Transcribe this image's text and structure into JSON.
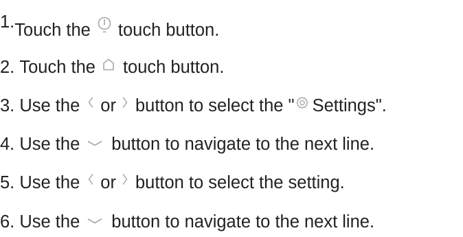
{
  "steps": [
    {
      "number": "1.",
      "parts": [
        "Touch the",
        "touch button."
      ],
      "icons": [
        "power-icon"
      ]
    },
    {
      "number": "2.",
      "parts": [
        "Touch the",
        "touch button."
      ],
      "icons": [
        "home-icon"
      ]
    },
    {
      "number": "3.",
      "parts": [
        "Use the",
        "or",
        "button to select the \"",
        "Settings\"."
      ],
      "icons": [
        "chevron-left-icon",
        "chevron-right-icon",
        "gear-icon"
      ]
    },
    {
      "number": "4.",
      "parts": [
        "Use the",
        "button to navigate to the next line."
      ],
      "icons": [
        "chevron-down-icon"
      ]
    },
    {
      "number": "5.",
      "parts": [
        "Use the",
        "or",
        "button to select the setting."
      ],
      "icons": [
        "chevron-left-icon",
        "chevron-right-icon"
      ]
    },
    {
      "number": "6.",
      "parts": [
        "Use the",
        "button to navigate to the next line."
      ],
      "icons": [
        "chevron-down-icon"
      ]
    }
  ],
  "colors": {
    "text": "#222222",
    "icon": "#a7a7a7",
    "background": "#ffffff"
  }
}
